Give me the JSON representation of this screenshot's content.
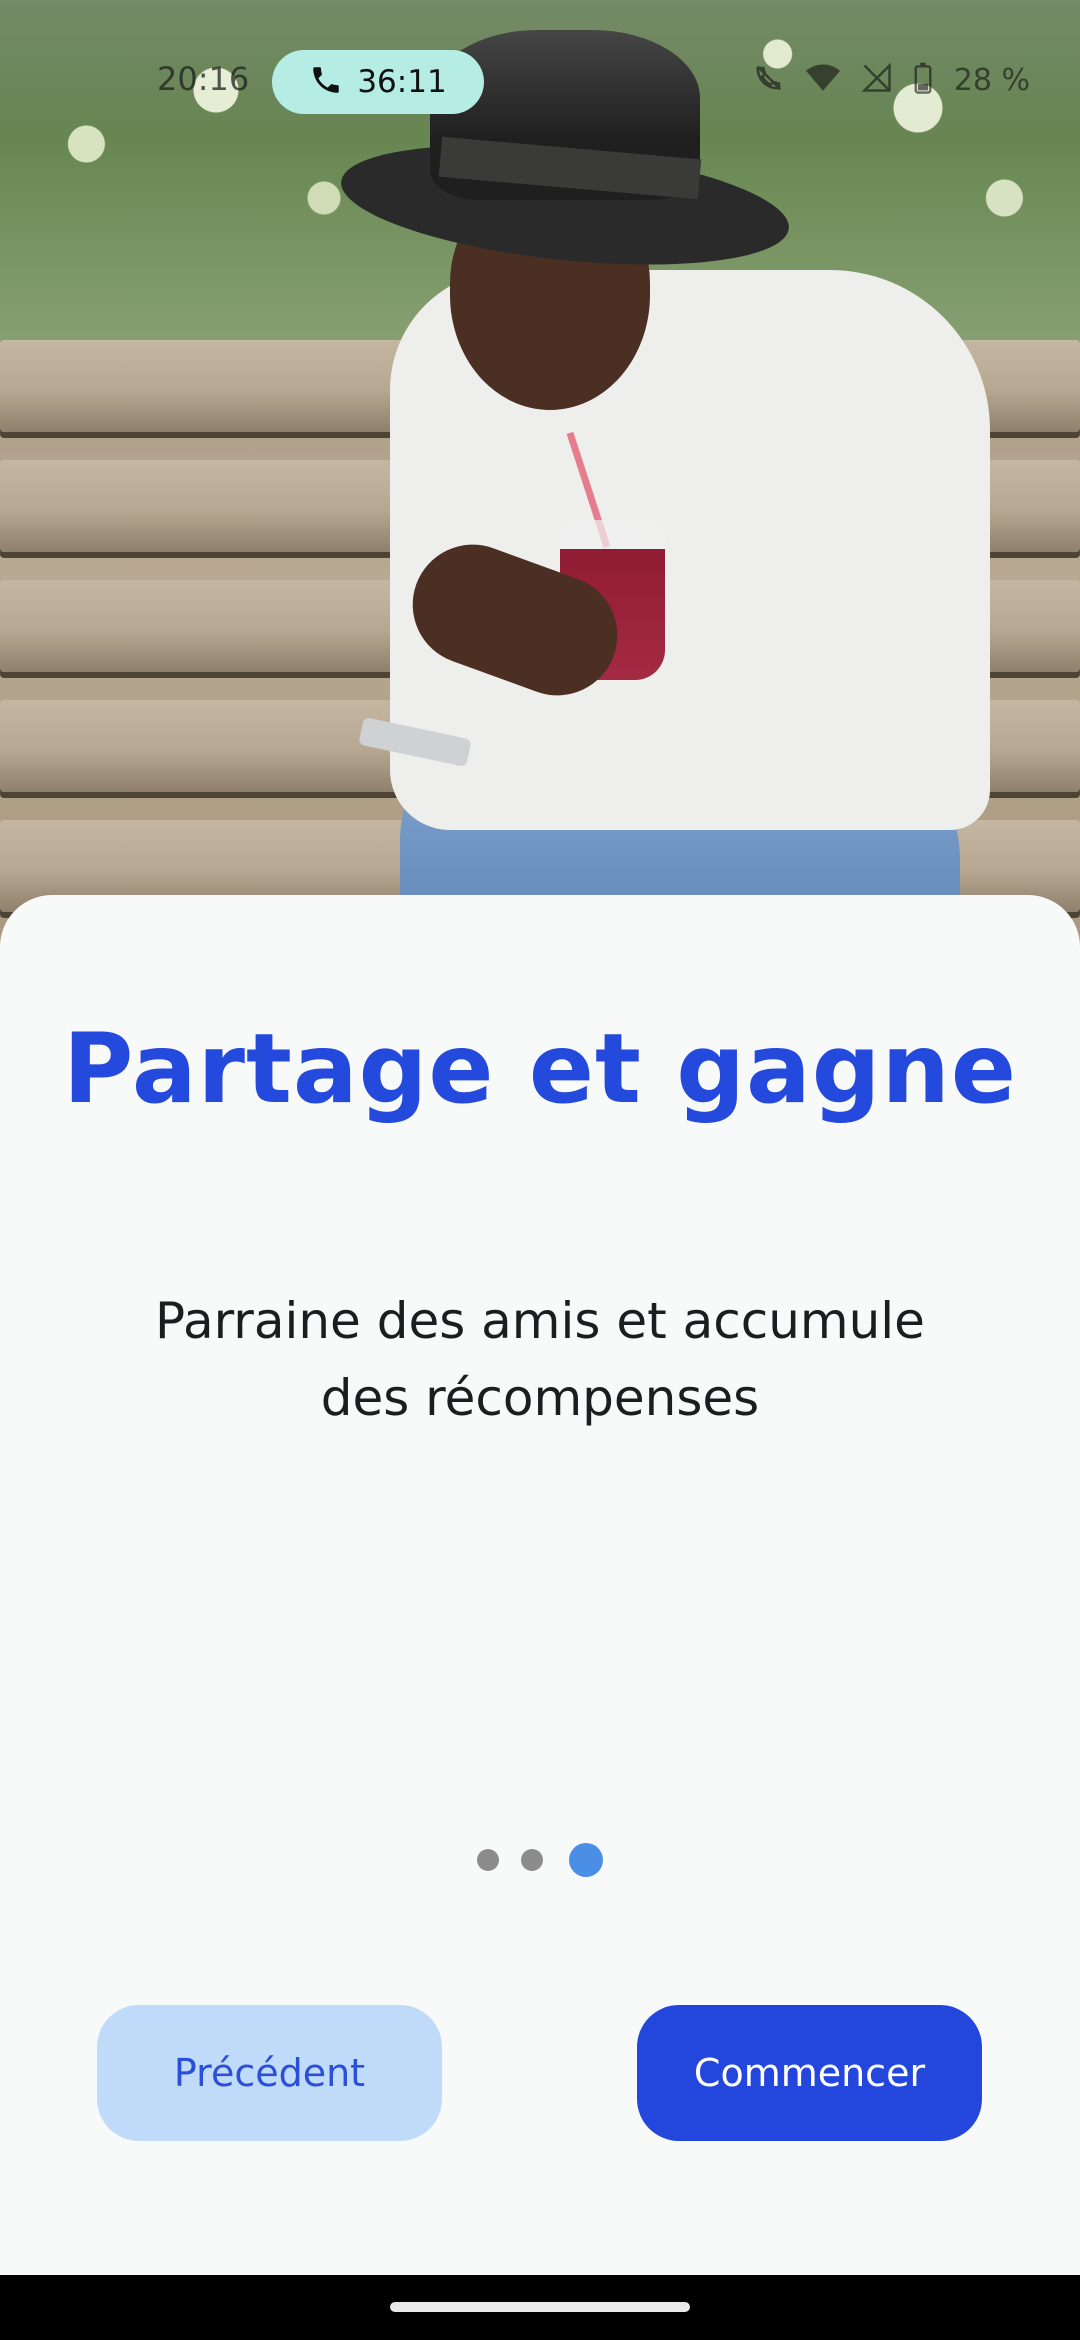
{
  "status_bar": {
    "time": "20:16",
    "call_timer": "36:11",
    "battery_percent": "28 %",
    "icons": [
      "phone-icon",
      "call-status-icon",
      "wifi-icon",
      "signal-icon",
      "battery-icon"
    ]
  },
  "hero": {
    "image": "person-on-bench-with-drink-and-phone"
  },
  "onboarding": {
    "title": "Partage et gagne",
    "subtitle": "Parraine des amis et accumule des récompenses",
    "page_indicator": {
      "count": 3,
      "active_index": 2
    },
    "previous_label": "Précédent",
    "start_label": "Commencer"
  },
  "colors": {
    "accent": "#2449dd",
    "secondary_button": "#c0dbfa",
    "active_dot": "#4a8ee6",
    "call_pill": "#b5ede4"
  }
}
